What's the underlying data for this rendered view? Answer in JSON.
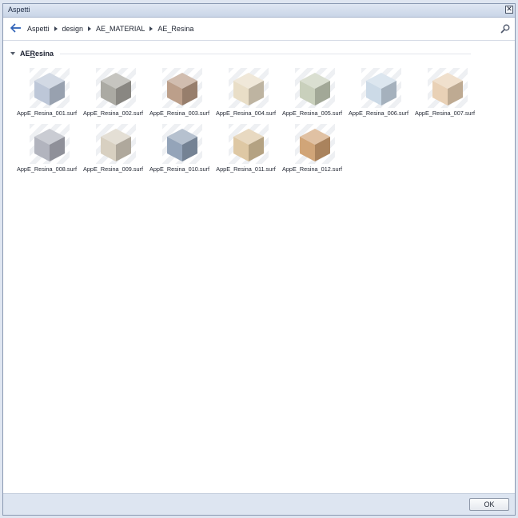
{
  "window": {
    "title": "Aspetti",
    "close_icon": "close-icon"
  },
  "toolbar": {
    "back_icon": "back-arrow-icon",
    "breadcrumb": [
      "Aspetti",
      "design",
      "AE_MATERIAL",
      "AE_Resina"
    ],
    "search_icon": "search-icon"
  },
  "group": {
    "title": "AE",
    "title_accel": "R",
    "title_rest": "esina"
  },
  "items": [
    {
      "label": "AppE_Resina_001.surf",
      "color": "#b9c4d6"
    },
    {
      "label": "AppE_Resina_002.surf",
      "color": "#a7a59e"
    },
    {
      "label": "AppE_Resina_003.surf",
      "color": "#b89a84"
    },
    {
      "label": "AppE_Resina_004.surf",
      "color": "#e8dcc4"
    },
    {
      "label": "AppE_Resina_005.surf",
      "color": "#c6cdb8"
    },
    {
      "label": "AppE_Resina_006.surf",
      "color": "#c9d8e6"
    },
    {
      "label": "AppE_Resina_007.surf",
      "color": "#e8cfb2"
    },
    {
      "label": "AppE_Resina_008.surf",
      "color": "#aeb0bb"
    },
    {
      "label": "AppE_Resina_009.surf",
      "color": "#d6cdbe"
    },
    {
      "label": "AppE_Resina_010.surf",
      "color": "#8e9fb5"
    },
    {
      "label": "AppE_Resina_011.surf",
      "color": "#dcc59f"
    },
    {
      "label": "AppE_Resina_012.surf",
      "color": "#cfa071"
    }
  ],
  "footer": {
    "ok_label": "OK"
  }
}
